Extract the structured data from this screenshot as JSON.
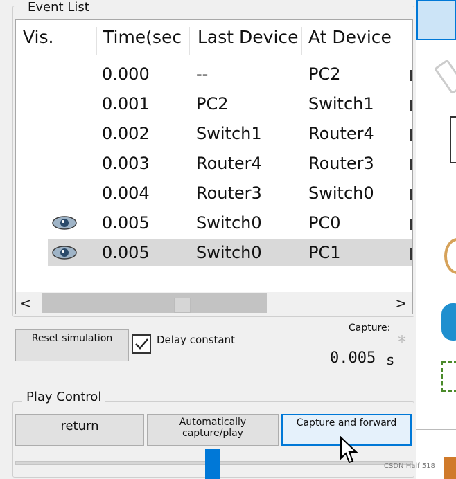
{
  "event_list": {
    "title": "Event List",
    "columns": [
      "Vis.",
      "Time(sec",
      "Last Device",
      "At Device"
    ],
    "rows": [
      {
        "vis": false,
        "time": "0.000",
        "last": "--",
        "at": "PC2"
      },
      {
        "vis": false,
        "time": "0.001",
        "last": "PC2",
        "at": "Switch1"
      },
      {
        "vis": false,
        "time": "0.002",
        "last": "Switch1",
        "at": "Router4"
      },
      {
        "vis": false,
        "time": "0.003",
        "last": "Router4",
        "at": "Router3"
      },
      {
        "vis": false,
        "time": "0.004",
        "last": "Router3",
        "at": "Switch0"
      },
      {
        "vis": true,
        "time": "0.005",
        "last": "Switch0",
        "at": "PC0"
      },
      {
        "vis": true,
        "time": "0.005",
        "last": "Switch0",
        "at": "PC1",
        "selected": true
      }
    ],
    "scroll_left": "<",
    "scroll_right": ">"
  },
  "controls": {
    "reset_label": "Reset simulation",
    "delay_label": "Delay constant",
    "delay_checked": true,
    "capture_label": "Capture:",
    "capture_value": "0.005",
    "capture_unit": "s",
    "star": "*"
  },
  "play_control": {
    "title": "Play Control",
    "return_label": "return",
    "auto_label": "Automatically capture/play",
    "forward_label": "Capture and forward"
  },
  "watermark": "CSDN Half 518",
  "colors": {
    "accent": "#0078d7",
    "selected_row": "#d9d9d9"
  }
}
